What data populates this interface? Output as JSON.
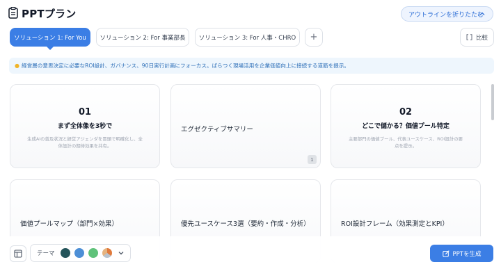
{
  "header": {
    "title": "PPTプラン",
    "collapse_label": "アウトラインを折りたたむ"
  },
  "tabs": [
    {
      "label": "ソリューション 1: For You",
      "active": true
    },
    {
      "label": "ソリューション 2: For 事業部長",
      "active": false
    },
    {
      "label": "ソリューション 3: For 人事・CHRO",
      "active": false
    }
  ],
  "add_tab_label": "+",
  "compare_label": "比較",
  "banner": {
    "icon": "lightbulb-icon",
    "text": "経営層の意思決定に必要なROI設計、ガバナンス、90日実行計画にフォーカス。ばらつく現場活用を企業価値向上に接続する道筋を提示。"
  },
  "cards": [
    {
      "num": "01",
      "heading": "まず全体像を3秒で",
      "desc": "生成AIの普及状況と経営アジェンダを冒頭で明確化し、全体設計の期待効果を共有。"
    },
    {
      "title": "エグゼクティブサマリー",
      "badge": "1"
    },
    {
      "num": "02",
      "heading": "どこで儲かる？価値プール特定",
      "desc": "主要部門の価値プール、代表ユースケース、ROI設計の要点を提示。"
    },
    {
      "title": "価値プールマップ（部門×効果）"
    },
    {
      "title": "優先ユースケース3選（要約・作成・分析）"
    },
    {
      "title": "ROI設計フレーム（効果測定とKPI）"
    }
  ],
  "bottom": {
    "theme_label": "テーマ",
    "swatches": [
      "#24545a",
      "#4d8fd6",
      "#5fc27a",
      "#e07a3c"
    ],
    "generate_label": "PPTを生成"
  },
  "colors": {
    "accent": "#3b7ee5",
    "banner_bg": "#eef6fd",
    "banner_text": "#2d6fb8"
  }
}
